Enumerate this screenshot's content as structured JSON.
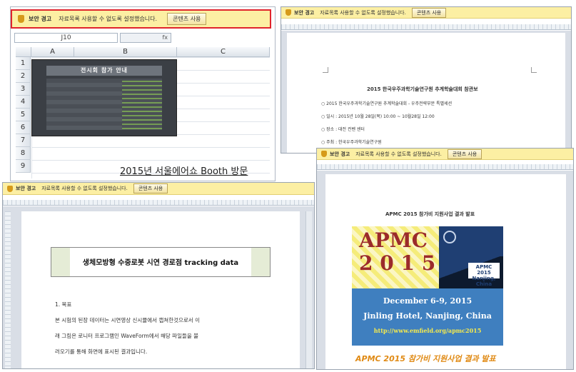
{
  "excel": {
    "security_warning": {
      "title": "보안 경고",
      "message": "자료목록 사용할 수 없도록 설정했습니다.",
      "button": "콘텐츠 사용"
    },
    "name_box": "J10",
    "columns": [
      "A",
      "B",
      "C"
    ],
    "rows": [
      "1",
      "2",
      "3",
      "4",
      "5",
      "6",
      "7",
      "8",
      "9"
    ],
    "embedded_table_title": "전시회 참가 안내",
    "sheet_heading": "2015년 서울에어쇼 Booth 방문"
  },
  "doc_top_right": {
    "security_warning": {
      "title": "보안 경고",
      "message": "자료목록 사용할 수 없도록 설정했습니다.",
      "button": "콘텐츠 사용"
    },
    "title": "2015 한국우주과학기술연구원 추계학술대회 참관보",
    "lines": [
      "○ 2015 한국우주과학기술연구원 추계학술대회 - 우주전략부문 특별세션",
      "○ 일시 : 2015년 10월 28일(목) 10:00 ~ 10월28일 12:00",
      "○ 장소 : 대전 컨벤 센터",
      "○ 주최 : 한국우주과학기술연구원"
    ]
  },
  "doc_bottom_left": {
    "security_warning": {
      "title": "보안 경고",
      "message": "자료목록 사용할 수 없도록 설정했습니다.",
      "button": "콘텐츠 사용"
    },
    "table_title": "생체모방형 수중로봇 시연 경로점 tracking data",
    "section": "1. 목표",
    "body": [
      "본 시험의 된장 데이터는 시연영상 신시뮬에서 캡쳐한것으로서 이",
      "래 그림은 로니터 프로그램인 WaveForm에서 해당 파일들을 불",
      "러오기를 통해 화면에 표시된 결과입니다."
    ]
  },
  "doc_bottom_right": {
    "security_warning": {
      "title": "보안 경고",
      "message": "자료목록 사용할 수 없도록 설정했습니다.",
      "button": "콘텐츠 사용"
    },
    "title": "APMC 2015 참가비 지원사업 결과 발표",
    "apmc_logo_line1": "APMC",
    "apmc_logo_line2": "2 0 1 5",
    "apmc_badge": "APMC 2015 Nanjing, China",
    "event_date": "December 6-9, 2015",
    "event_venue": "Jinling Hotel, Nanjing, China",
    "event_url": "http://www.emfield.org/apmc2015",
    "caption": "APMC 2015 참가비 지원사업 결과 발표"
  },
  "colors": {
    "warning_bar": "#fcefa3",
    "highlight_border": "#e0242c",
    "apmc_blue": "#3f7fbf",
    "apmc_yellow": "#f5ec7a",
    "caption_orange": "#e08a14"
  }
}
